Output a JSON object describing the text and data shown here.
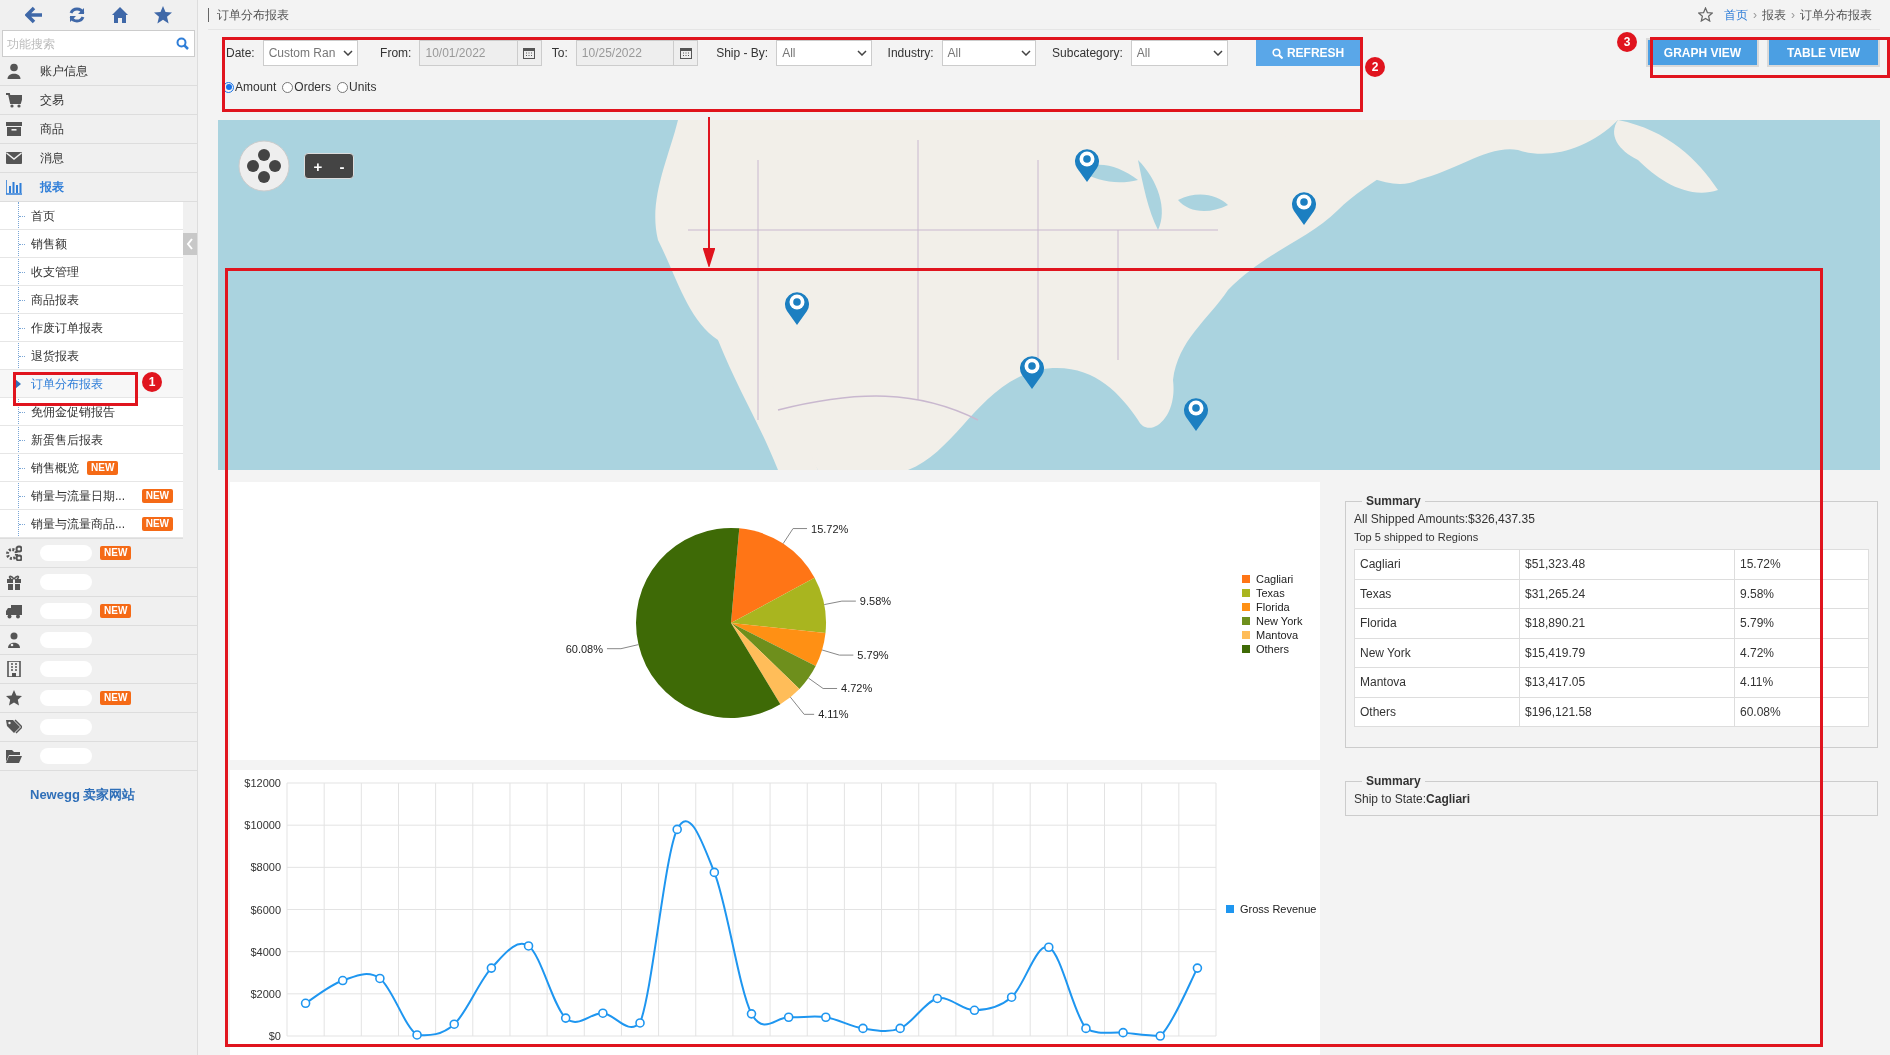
{
  "sidebar": {
    "search": {
      "placeholder": "功能搜索"
    },
    "items": [
      {
        "kind": "item",
        "label": "账户信息",
        "selected": false
      },
      {
        "kind": "item",
        "label": "交易",
        "selected": false
      },
      {
        "kind": "item",
        "label": "商品",
        "selected": false
      },
      {
        "kind": "item",
        "label": "消息",
        "selected": false
      },
      {
        "kind": "item",
        "label": "报表",
        "selected": true,
        "expanded": true,
        "children": [
          {
            "label": "首页",
            "selected": false
          },
          {
            "label": "销售额",
            "selected": false
          },
          {
            "label": "收支管理",
            "selected": false
          },
          {
            "label": "商品报表",
            "selected": false
          },
          {
            "label": "作废订单报表",
            "selected": false
          },
          {
            "label": "退货报表",
            "selected": false
          },
          {
            "label": "订单分布报表",
            "selected": true
          },
          {
            "label": "免佣金促销报告",
            "selected": false
          },
          {
            "label": "新蛋售后报表",
            "selected": false
          },
          {
            "label": "销售概览",
            "selected": false,
            "badge": "NEW"
          },
          {
            "label": "销量与流量日期...",
            "selected": false,
            "badge": "NEW"
          },
          {
            "label": "销量与流量商品...",
            "selected": false,
            "badge": "NEW"
          }
        ]
      },
      {
        "kind": "redacted",
        "badge": "NEW"
      },
      {
        "kind": "redacted"
      },
      {
        "kind": "redacted",
        "badge": "NEW"
      },
      {
        "kind": "redacted"
      },
      {
        "kind": "redacted"
      },
      {
        "kind": "redacted",
        "badge": "NEW"
      },
      {
        "kind": "redacted"
      },
      {
        "kind": "redacted"
      }
    ],
    "footer_link": "Newegg 卖家网站"
  },
  "page_title": "订单分布报表",
  "breadcrumb": [
    "首页",
    "报表",
    "订单分布报表"
  ],
  "breadcrumb_separator": "›",
  "filters": {
    "fields": [
      {
        "kind": "select",
        "label": "Date:",
        "value": "Custom Ran"
      },
      {
        "kind": "date",
        "label": "From:",
        "value": "10/01/2022",
        "disabled": true
      },
      {
        "kind": "date",
        "label": "To:",
        "value": "10/25/2022",
        "disabled": true
      },
      {
        "kind": "select",
        "label": "Ship - By:",
        "value": "All"
      },
      {
        "kind": "select",
        "label": "Industry:",
        "value": "All"
      },
      {
        "kind": "select",
        "label": "Subcategory:",
        "value": "All"
      }
    ],
    "refresh": "REFRESH",
    "measures": [
      {
        "label": "Amount",
        "selected": true
      },
      {
        "label": "Orders",
        "selected": false
      },
      {
        "label": "Units",
        "selected": false
      }
    ]
  },
  "view_buttons": [
    "GRAPH VIEW",
    "TABLE VIEW"
  ],
  "map": {
    "kind": "picture",
    "zoom_in": "+",
    "zoom_out": "-"
  },
  "pie": {
    "chart_data": {
      "type": "pie",
      "categories": [
        "Cagliari",
        "Texas",
        "Florida",
        "New York",
        "Mantova",
        "Others"
      ],
      "values": [
        15.72,
        9.58,
        5.79,
        4.72,
        4.11,
        60.08
      ],
      "value_labels": [
        "15.72%",
        "9.58%",
        "5.79%",
        "4.72%",
        "4.11%",
        "60.08%"
      ],
      "colors": [
        "#ff7516",
        "#a9b51f",
        "#ff9014",
        "#6e8f1c",
        "#ffbd59",
        "#3e6a06"
      ],
      "legend": "right"
    }
  },
  "summary": {
    "title": "Summary",
    "total": "All Shipped Amounts:$326,437.35",
    "subtitle": "Top 5 shipped to Regions",
    "rows": [
      [
        "Cagliari",
        "$51,323.48",
        "15.72%"
      ],
      [
        "Texas",
        "$31,265.24",
        "9.58%"
      ],
      [
        "Florida",
        "$18,890.21",
        "5.79%"
      ],
      [
        "New York",
        "$15,419.79",
        "4.72%"
      ],
      [
        "Mantova",
        "$13,417.05",
        "4.11%"
      ],
      [
        "Others",
        "$196,121.58",
        "60.08%"
      ]
    ]
  },
  "line": {
    "chart_data": {
      "type": "line",
      "grid": true,
      "marker": true,
      "ylim": [
        0,
        12000
      ],
      "yticks": [
        {
          "value": 0,
          "label": "$0"
        },
        {
          "value": 2000,
          "label": "$2000"
        },
        {
          "value": 4000,
          "label": "$4000"
        },
        {
          "value": 6000,
          "label": "$6000"
        },
        {
          "value": 8000,
          "label": "$8000"
        },
        {
          "value": 10000,
          "label": "$10000"
        },
        {
          "value": 12000,
          "label": "$12000"
        }
      ],
      "series": [
        {
          "name": "Gross Revenue",
          "color": "#1e96f0",
          "values": [
            1550,
            2630,
            2730,
            50,
            560,
            3220,
            4270,
            850,
            1080,
            620,
            9800,
            7760,
            1050,
            890,
            890,
            360,
            360,
            1780,
            1220,
            1840,
            4210,
            360,
            160,
            0,
            3220
          ]
        }
      ]
    }
  },
  "summary2": {
    "title": "Summary",
    "text": "Ship to State:**Cagliari**"
  },
  "annotations": [
    "1",
    "2",
    "3"
  ]
}
